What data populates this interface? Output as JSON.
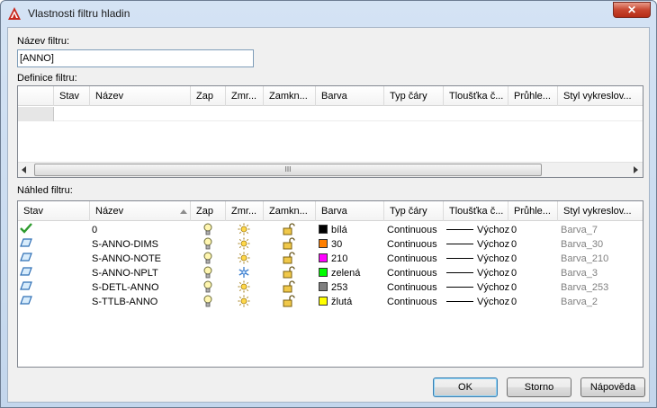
{
  "window": {
    "title": "Vlastnosti filtru hladin",
    "close_glyph": "✕"
  },
  "filter_name": {
    "label": "Název filtru:",
    "value": "[ANNO]"
  },
  "definition": {
    "label": "Definice filtru:",
    "columns": [
      "Stav",
      "Název",
      "Zap",
      "Zmr...",
      "Zamkn...",
      "Barva",
      "Typ čáry",
      "Tloušťka č...",
      "Průhle...",
      "Styl vykreslov..."
    ],
    "scroll_glyph": "III"
  },
  "preview": {
    "label": "Náhled filtru:",
    "columns": [
      "Stav",
      "Název",
      "Zap",
      "Zmr...",
      "Zamkn...",
      "Barva",
      "Typ čáry",
      "Tloušťka č...",
      "Průhle...",
      "Styl vykreslov..."
    ],
    "rows": [
      {
        "status": "check-icon",
        "name": "0",
        "on": "bulb-icon",
        "freeze": "sun-icon",
        "lock": "unlock-icon",
        "color_hex": "#000000",
        "color_name": "bílá",
        "linetype": "Continuous",
        "lineweight": "Výchozí",
        "transparency": "0",
        "plotstyle": "Barva_7"
      },
      {
        "status": "layer-icon",
        "name": "S-ANNO-DIMS",
        "on": "bulb-icon",
        "freeze": "sun-icon",
        "lock": "unlock-icon",
        "color_hex": "#ff7f00",
        "color_name": "30",
        "linetype": "Continuous",
        "lineweight": "Výchozí",
        "transparency": "0",
        "plotstyle": "Barva_30"
      },
      {
        "status": "layer-icon",
        "name": "S-ANNO-NOTE",
        "on": "bulb-icon",
        "freeze": "sun-icon",
        "lock": "unlock-icon",
        "color_hex": "#ff00ff",
        "color_name": "210",
        "linetype": "Continuous",
        "lineweight": "Výchozí",
        "transparency": "0",
        "plotstyle": "Barva_210"
      },
      {
        "status": "layer-icon",
        "name": "S-ANNO-NPLT",
        "on": "bulb-icon",
        "freeze": "snowflake-icon",
        "lock": "unlock-icon",
        "color_hex": "#00ff00",
        "color_name": "zelená",
        "linetype": "Continuous",
        "lineweight": "Výchozí",
        "transparency": "0",
        "plotstyle": "Barva_3"
      },
      {
        "status": "layer-icon",
        "name": "S-DETL-ANNO",
        "on": "bulb-icon",
        "freeze": "sun-icon",
        "lock": "unlock-icon",
        "color_hex": "#808080",
        "color_name": "253",
        "linetype": "Continuous",
        "lineweight": "Výchozí",
        "transparency": "0",
        "plotstyle": "Barva_253"
      },
      {
        "status": "layer-icon",
        "name": "S-TTLB-ANNO",
        "on": "bulb-icon",
        "freeze": "sun-icon",
        "lock": "unlock-icon",
        "color_hex": "#ffff00",
        "color_name": "žlutá",
        "linetype": "Continuous",
        "lineweight": "Výchozí",
        "transparency": "0",
        "plotstyle": "Barva_2"
      }
    ]
  },
  "buttons": {
    "ok": "OK",
    "cancel": "Storno",
    "help": "Nápověda"
  }
}
